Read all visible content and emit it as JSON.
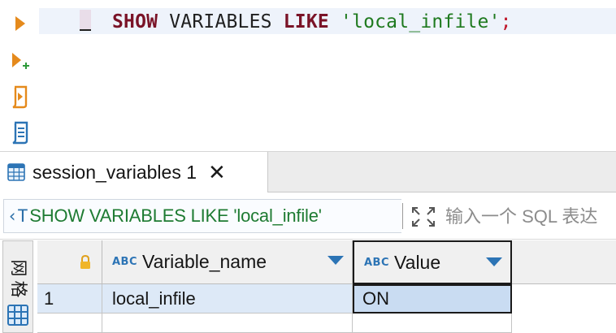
{
  "editor": {
    "code": {
      "kw_show": "SHOW",
      "variables": " VARIABLES ",
      "kw_like": "LIKE",
      "string": " 'local_infile'",
      "semicolon": ";"
    }
  },
  "gutter": {
    "icons": [
      "execute-statement-icon",
      "execute-in-new-tab-icon",
      "execute-script-icon",
      "explain-plan-icon"
    ]
  },
  "result_tab": {
    "label": "session_variables 1",
    "close_glyph": "✕"
  },
  "filter_bar": {
    "sql_text": "SHOW VARIABLES LIKE 'local_infile'",
    "placeholder": "输入一个 SQL 表达"
  },
  "side_tab": {
    "label_line1": "网",
    "label_line2": "格"
  },
  "grid": {
    "columns": [
      {
        "type_badge": "ABC",
        "label": "Variable_name"
      },
      {
        "type_badge": "ABC",
        "label": "Value"
      }
    ],
    "rows": [
      {
        "row_number": "1",
        "cells": [
          "local_infile",
          "ON"
        ]
      }
    ]
  },
  "colors": {
    "keyword": "#7a1327",
    "string": "#1f7a1f",
    "accent": "#2c74b5",
    "selected_row": "#dde9f7",
    "selected_cell": "#c9dcf2"
  }
}
